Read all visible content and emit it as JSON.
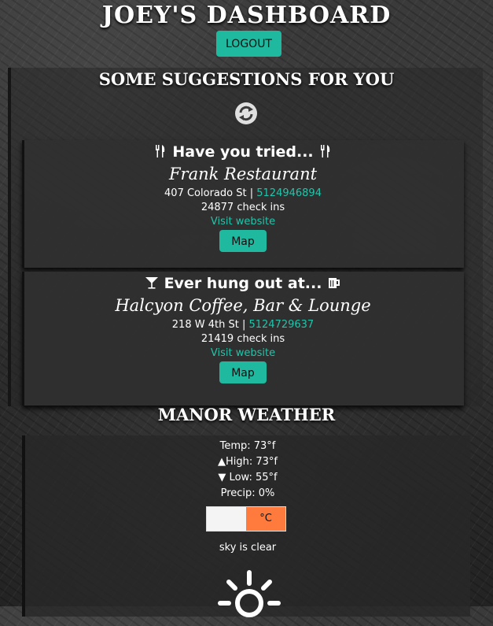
{
  "header": {
    "title": "JOEY'S DASHBOARD",
    "logout_label": "LOGOUT"
  },
  "suggestions": {
    "heading": "SOME SUGGESTIONS FOR YOU",
    "cards": [
      {
        "heading": "Have you tried...",
        "name": "Frank Restaurant",
        "address": "407 Colorado St",
        "separator": "|",
        "phone": "5124946894",
        "checkins": "24877 check ins",
        "website": "Visit website",
        "map_label": "Map"
      },
      {
        "heading": "Ever hung out at...",
        "name": "Halcyon Coffee, Bar & Lounge",
        "address": "218 W 4th St",
        "separator": "|",
        "phone": "5124729637",
        "checkins": "21419 check ins",
        "website": "Visit website",
        "map_label": "Map"
      }
    ]
  },
  "weather": {
    "heading": "MANOR WEATHER",
    "temp": "Temp: 73°f",
    "high": "▲High: 73°f",
    "low": "▼ Low: 55°f",
    "precip": "Precip: 0%",
    "unit_c": "°C",
    "sky": "sky is clear",
    "icon": "sun-icon"
  },
  "colors": {
    "accent": "#1fb99f",
    "link": "#20c5aa",
    "toggle_active": "#ff7a3d"
  }
}
